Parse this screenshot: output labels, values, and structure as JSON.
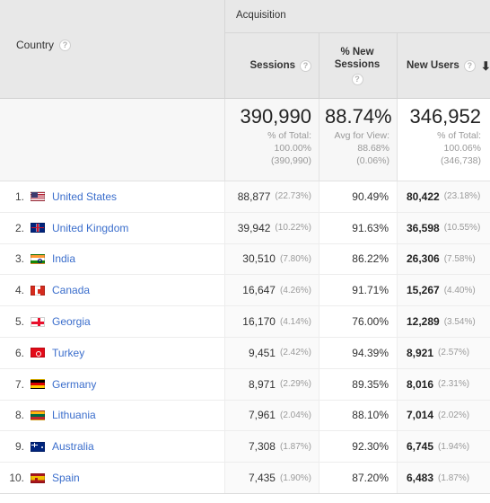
{
  "header": {
    "dimension_label": "Country",
    "dimension_help_icon": "question-mark-icon",
    "group_label": "Acquisition",
    "metrics": [
      {
        "label": "Sessions",
        "help_icon": "question-mark-icon",
        "sorted": false
      },
      {
        "label": "% New\nSessions",
        "label_line1": "% New",
        "label_line2": "Sessions",
        "help_icon": "question-mark-icon",
        "sorted": false
      },
      {
        "label": "New Users",
        "help_icon": "question-mark-icon",
        "sorted": true,
        "sort_icon": "arrow-down-icon",
        "sort_direction": "descending"
      }
    ]
  },
  "summary": {
    "sessions": {
      "value": "390,990",
      "sub_label": "% of Total:",
      "sub_value": "100.00%",
      "sub_paren": "(390,990)"
    },
    "pct_new_sessions": {
      "value": "88.74%",
      "sub_label": "Avg for View:",
      "sub_value": "88.68%",
      "sub_paren": "(0.06%)"
    },
    "new_users": {
      "value": "346,952",
      "sub_label": "% of Total:",
      "sub_value": "100.06%",
      "sub_paren": "(346,738)"
    }
  },
  "rows": [
    {
      "rank": "1.",
      "country": "United States",
      "flag": "flag-us",
      "sessions": "88,877",
      "sessions_pct": "(22.73%)",
      "pct_new_sessions": "90.49%",
      "new_users": "80,422",
      "new_users_pct": "(23.18%)"
    },
    {
      "rank": "2.",
      "country": "United Kingdom",
      "flag": "flag-gb",
      "sessions": "39,942",
      "sessions_pct": "(10.22%)",
      "pct_new_sessions": "91.63%",
      "new_users": "36,598",
      "new_users_pct": "(10.55%)"
    },
    {
      "rank": "3.",
      "country": "India",
      "flag": "flag-in",
      "sessions": "30,510",
      "sessions_pct": "(7.80%)",
      "pct_new_sessions": "86.22%",
      "new_users": "26,306",
      "new_users_pct": "(7.58%)"
    },
    {
      "rank": "4.",
      "country": "Canada",
      "flag": "flag-ca",
      "sessions": "16,647",
      "sessions_pct": "(4.26%)",
      "pct_new_sessions": "91.71%",
      "new_users": "15,267",
      "new_users_pct": "(4.40%)"
    },
    {
      "rank": "5.",
      "country": "Georgia",
      "flag": "flag-ge",
      "sessions": "16,170",
      "sessions_pct": "(4.14%)",
      "pct_new_sessions": "76.00%",
      "new_users": "12,289",
      "new_users_pct": "(3.54%)"
    },
    {
      "rank": "6.",
      "country": "Turkey",
      "flag": "flag-tr",
      "sessions": "9,451",
      "sessions_pct": "(2.42%)",
      "pct_new_sessions": "94.39%",
      "new_users": "8,921",
      "new_users_pct": "(2.57%)"
    },
    {
      "rank": "7.",
      "country": "Germany",
      "flag": "flag-de",
      "sessions": "8,971",
      "sessions_pct": "(2.29%)",
      "pct_new_sessions": "89.35%",
      "new_users": "8,016",
      "new_users_pct": "(2.31%)"
    },
    {
      "rank": "8.",
      "country": "Lithuania",
      "flag": "flag-lt",
      "sessions": "7,961",
      "sessions_pct": "(2.04%)",
      "pct_new_sessions": "88.10%",
      "new_users": "7,014",
      "new_users_pct": "(2.02%)"
    },
    {
      "rank": "9.",
      "country": "Australia",
      "flag": "flag-au",
      "sessions": "7,308",
      "sessions_pct": "(1.87%)",
      "pct_new_sessions": "92.30%",
      "new_users": "6,745",
      "new_users_pct": "(1.94%)"
    },
    {
      "rank": "10.",
      "country": "Spain",
      "flag": "flag-es",
      "sessions": "7,435",
      "sessions_pct": "(1.90%)",
      "pct_new_sessions": "87.20%",
      "new_users": "6,483",
      "new_users_pct": "(1.87%)"
    }
  ],
  "colors": {
    "link": "#3b6ecc",
    "header_bg": "#e8e8e8",
    "summary_bg": "#f7f7f7",
    "alt_column_bg": "#fafafa",
    "muted_text": "#9a9a9a"
  }
}
